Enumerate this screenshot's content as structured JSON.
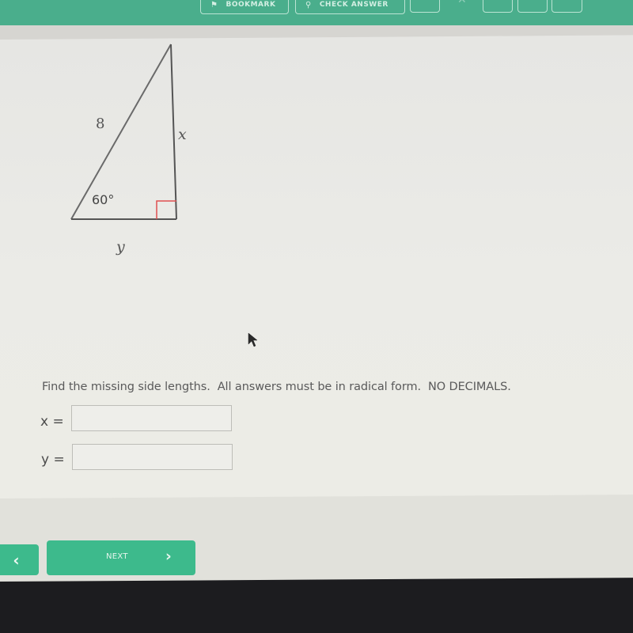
{
  "toolbar": {
    "bookmark_label": "BOOKMARK",
    "check_answer_label": "CHECK ANSWER",
    "icons": [
      "bookmark-icon",
      "check-answer-icon",
      "calculator-icon",
      "close-icon",
      "reference-icon",
      "tool-icon",
      "more-icon"
    ]
  },
  "figure": {
    "hypotenuse_label": "8",
    "vertical_leg_label": "x",
    "horizontal_leg_label": "y",
    "angle_label": "60°",
    "right_angle_marker_color": "#e05050"
  },
  "question": {
    "instructions": "Find the missing side lengths.  All answers must be in radical form.  NO DECIMALS."
  },
  "answers": [
    {
      "label": "x =",
      "value": "",
      "placeholder": ""
    },
    {
      "label": "y =",
      "value": "",
      "placeholder": ""
    }
  ],
  "navigation": {
    "prev_icon": "‹",
    "next_label": "NEXT",
    "next_icon": "›"
  },
  "colors": {
    "accent": "#3dba8c",
    "toolbar": "#4aae8c"
  }
}
